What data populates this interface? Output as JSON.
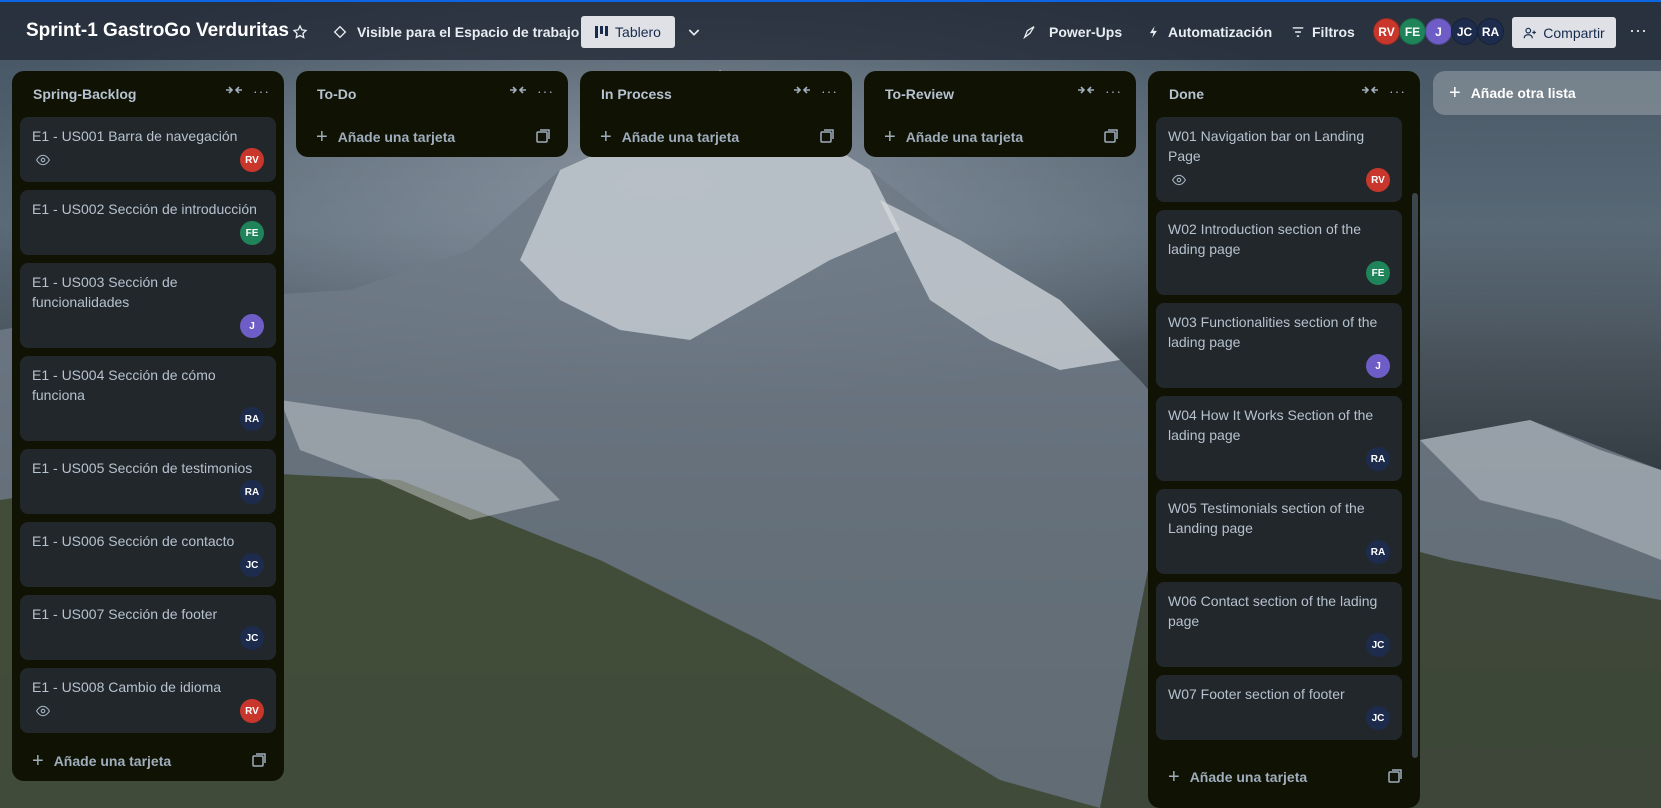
{
  "board": {
    "title": "Sprint-1 GastroGo Verduritas",
    "visibility": "Visible para el Espacio de trabajo",
    "view": "Tablero"
  },
  "header": {
    "powerups": "Power-Ups",
    "automation": "Automatización",
    "filters": "Filtros",
    "share": "Compartir",
    "members": [
      {
        "initials": "RV",
        "color": "#c9372c"
      },
      {
        "initials": "FE",
        "color": "#1f845a"
      },
      {
        "initials": "J",
        "color": "#6e5dc6"
      },
      {
        "initials": "JC",
        "color": "#1d2c4c"
      },
      {
        "initials": "RA",
        "color": "#1d2c4c"
      }
    ]
  },
  "colors": {
    "RV": "#c9372c",
    "FE": "#1f845a",
    "J": "#6e5dc6",
    "JC": "#1d2c4c",
    "RA": "#1d2c4c"
  },
  "add_card_label": "Añade una tarjeta",
  "add_list_label": "Añade otra lista",
  "lists": [
    {
      "title": "Spring-Backlog",
      "cards": [
        {
          "text": "E1 - US001 Barra de navegación",
          "watch": true,
          "member": "RV"
        },
        {
          "text": "E1 - US002 Sección de introducción",
          "watch": false,
          "member": "FE"
        },
        {
          "text": "E1 - US003 Sección de funcionalidades",
          "watch": false,
          "member": "J"
        },
        {
          "text": "E1 - US004 Sección de cómo funciona",
          "watch": false,
          "member": "RA"
        },
        {
          "text": "E1 - US005 Sección de testimonios",
          "watch": false,
          "member": "RA"
        },
        {
          "text": "E1 - US006 Sección de contacto",
          "watch": false,
          "member": "JC"
        },
        {
          "text": "E1 - US007 Sección de footer",
          "watch": false,
          "member": "JC"
        },
        {
          "text": "E1 - US008 Cambio de idioma",
          "watch": true,
          "member": "RV"
        }
      ]
    },
    {
      "title": "To-Do",
      "cards": []
    },
    {
      "title": "In Process",
      "cards": []
    },
    {
      "title": "To-Review",
      "cards": []
    },
    {
      "title": "Done",
      "cards": [
        {
          "text": "W01 Navigation bar on Landing Page",
          "watch": true,
          "member": "RV"
        },
        {
          "text": "W02 Introduction section of the lading page",
          "watch": false,
          "member": "FE"
        },
        {
          "text": "W03 Functionalities section of the lading page",
          "watch": false,
          "member": "J"
        },
        {
          "text": "W04 How It Works Section of the lading page",
          "watch": false,
          "member": "RA"
        },
        {
          "text": "W05 Testimonials section of the Landing page",
          "watch": false,
          "member": "RA"
        },
        {
          "text": "W06 Contact section of the lading page",
          "watch": false,
          "member": "JC"
        },
        {
          "text": "W07 Footer section of footer",
          "watch": false,
          "member": "JC"
        }
      ]
    }
  ]
}
